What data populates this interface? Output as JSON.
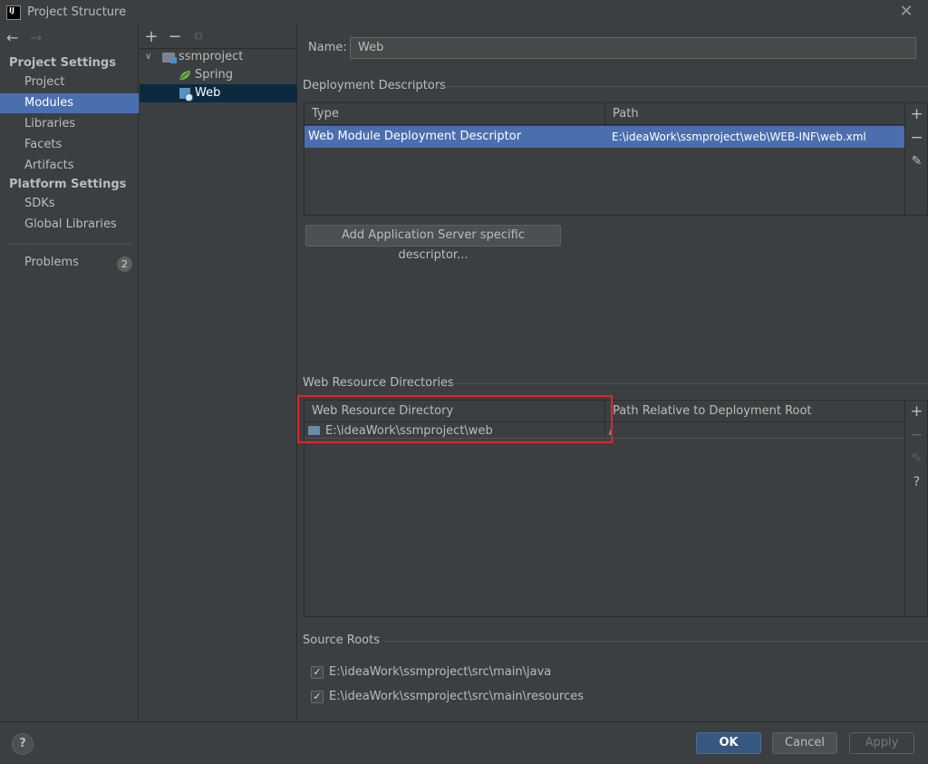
{
  "window": {
    "title": "Project Structure",
    "app_icon_text": "IJ",
    "close_symbol": "✕"
  },
  "nav": {
    "back": "←",
    "forward": "→",
    "project_settings_header": "Project Settings",
    "project_settings_items": [
      "Project",
      "Modules",
      "Libraries",
      "Facets",
      "Artifacts"
    ],
    "selected": "Modules",
    "platform_settings_header": "Platform Settings",
    "platform_settings_items": [
      "SDKs",
      "Global Libraries"
    ],
    "problems_label": "Problems",
    "problems_count": "2"
  },
  "tree": {
    "toolbar": {
      "add": "+",
      "remove": "−",
      "copy": "⧉"
    },
    "items": [
      {
        "label": "ssmproject",
        "icon": "module-folder-icon"
      },
      {
        "label": "Spring",
        "icon": "spring-leaf-icon"
      },
      {
        "label": "Web",
        "icon": "web-facet-icon"
      }
    ],
    "selected": "Web"
  },
  "facet": {
    "name_label": "Name:",
    "name_value": "Web",
    "deployment_descriptors": {
      "title": "Deployment Descriptors",
      "columns": [
        "Type",
        "Path"
      ],
      "rows": [
        {
          "type": "Web Module Deployment Descriptor",
          "path": "E:\\ideaWork\\ssmproject\\web\\WEB-INF\\web.xml"
        }
      ],
      "tools": {
        "add": "+",
        "remove": "−",
        "edit": "✎"
      },
      "add_server_button": "Add Application Server specific descriptor..."
    },
    "web_resource_directories": {
      "title": "Web Resource Directories",
      "columns": [
        "Web Resource Directory",
        "Path Relative to Deployment Root"
      ],
      "rows": [
        {
          "directory": "E:\\ideaWork\\ssmproject\\web",
          "relative_path": "/"
        }
      ],
      "tools": {
        "add": "+",
        "remove": "−",
        "edit": "✎",
        "help": "?"
      }
    },
    "source_roots": {
      "title": "Source Roots",
      "items": [
        {
          "path": "E:\\ideaWork\\ssmproject\\src\\main\\java",
          "checked": true
        },
        {
          "path": "E:\\ideaWork\\ssmproject\\src\\main\\resources",
          "checked": true
        }
      ],
      "check_mark": "✓"
    }
  },
  "buttons": {
    "help": "?",
    "ok": "OK",
    "cancel": "Cancel",
    "apply": "Apply"
  },
  "colors": {
    "background": "#3c3f41",
    "selection": "#4b6eaf",
    "tree_selection": "#0d293e",
    "highlight_box": "#e0252b",
    "ok_button": "#365880"
  }
}
